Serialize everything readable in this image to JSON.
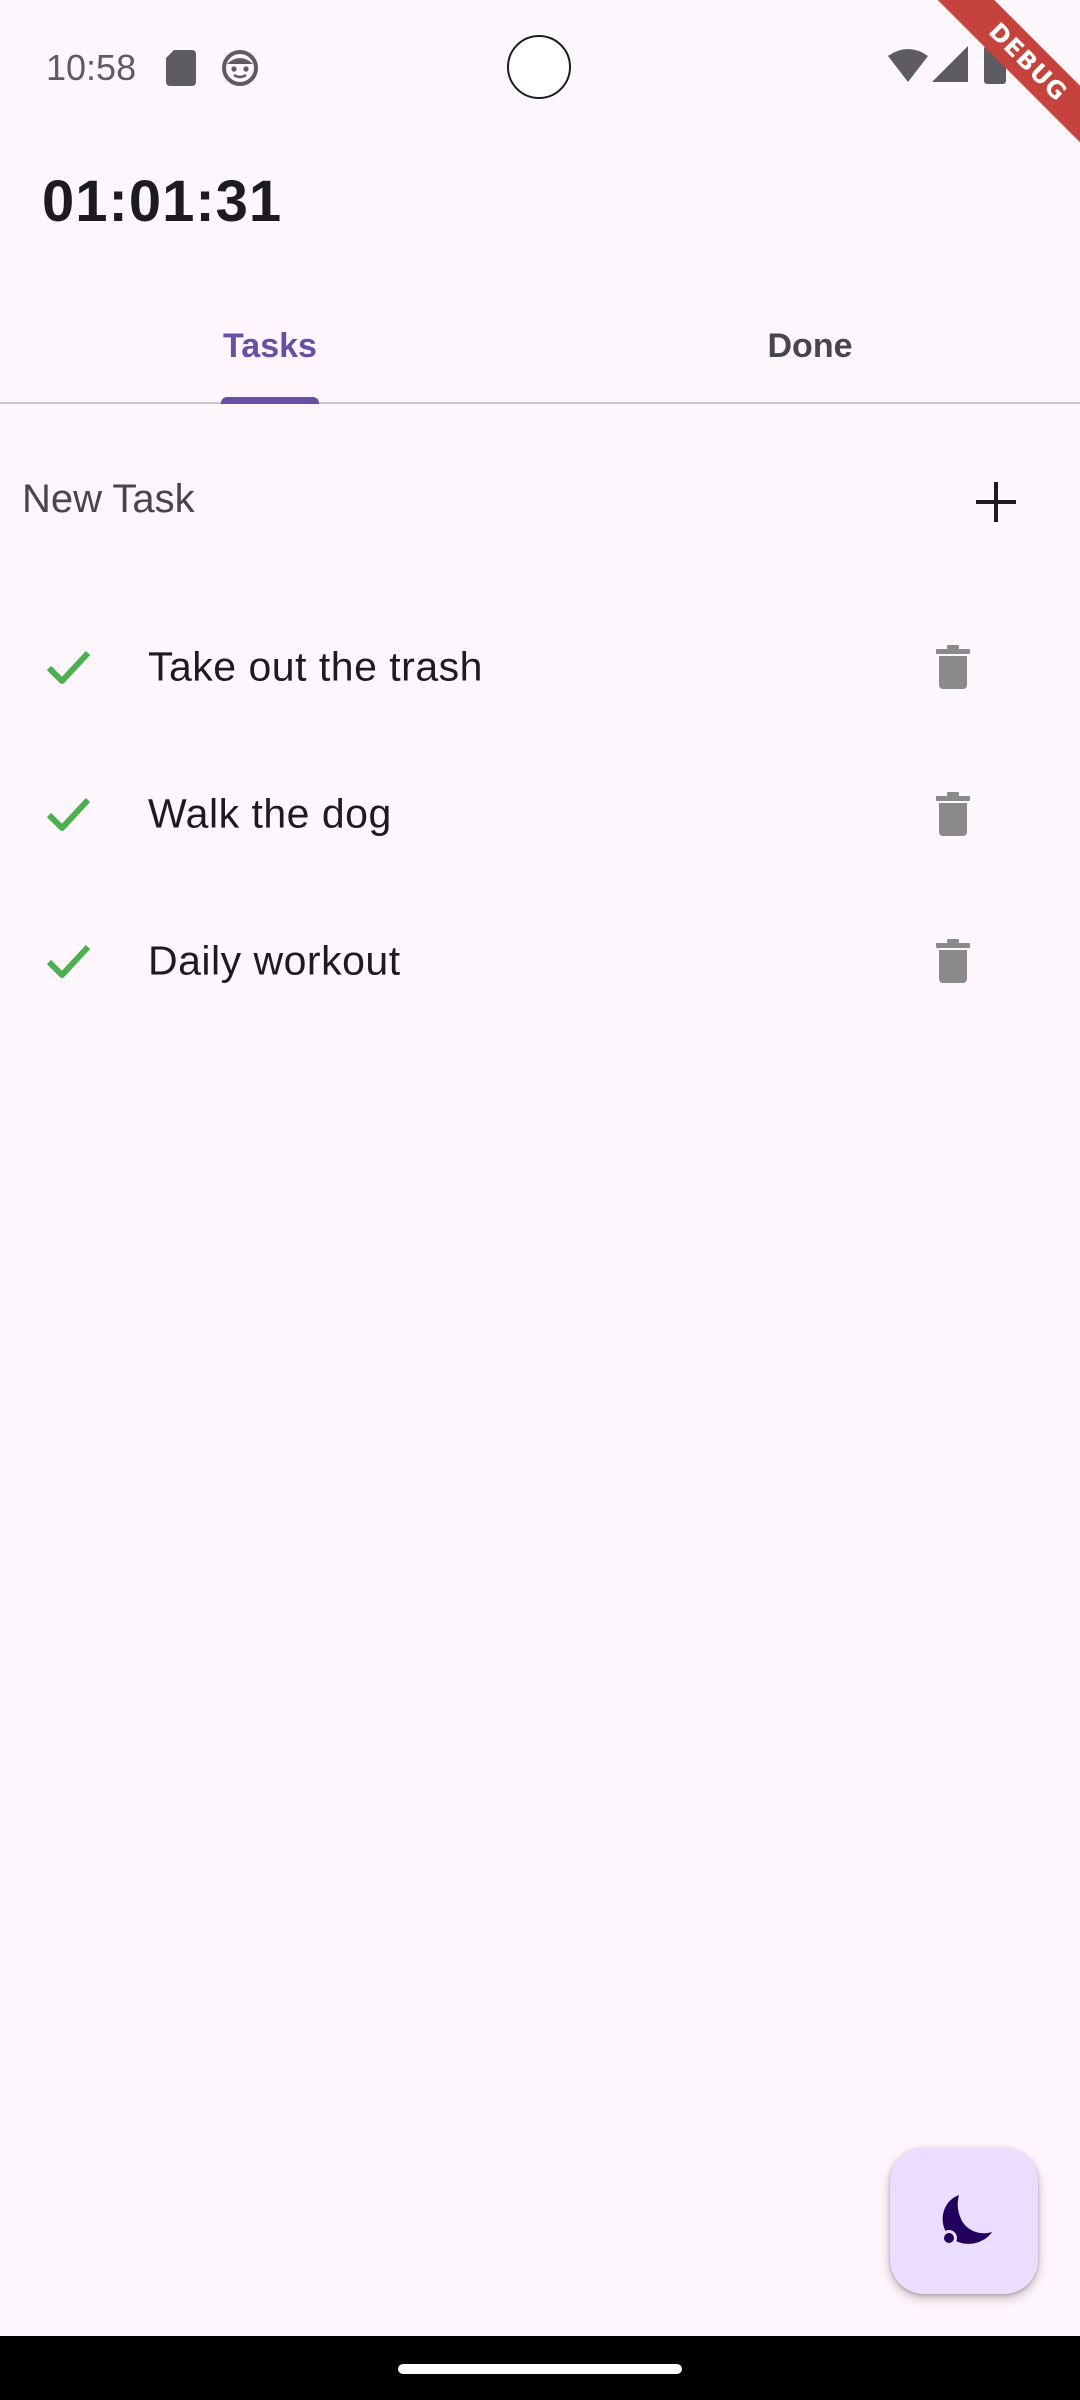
{
  "status_bar": {
    "time": "10:58",
    "icons": [
      "sd-card-icon",
      "face-icon",
      "wifi-icon",
      "signal-icon",
      "battery-icon"
    ]
  },
  "debug_banner": {
    "label": "DEBUG",
    "color": "#c6433d"
  },
  "timer": {
    "value": "01:01:31"
  },
  "tabs": [
    {
      "label": "Tasks",
      "selected": true
    },
    {
      "label": "Done",
      "selected": false
    }
  ],
  "new_task": {
    "placeholder": "New Task",
    "value": "",
    "add_icon": "plus-icon"
  },
  "tasks": [
    {
      "label": "Take out the trash",
      "status_icon": "check-icon",
      "action_icon": "trash-icon"
    },
    {
      "label": "Walk the dog",
      "status_icon": "check-icon",
      "action_icon": "trash-icon"
    },
    {
      "label": "Daily workout",
      "status_icon": "check-icon",
      "action_icon": "trash-icon"
    }
  ],
  "fab": {
    "icon": "moon-icon"
  },
  "colors": {
    "background": "#fdf6fc",
    "accent": "#6750a4",
    "check": "#4caf50",
    "trash": "#8a8a8a",
    "fab_background": "#eaddff",
    "fab_icon": "#21005d"
  }
}
